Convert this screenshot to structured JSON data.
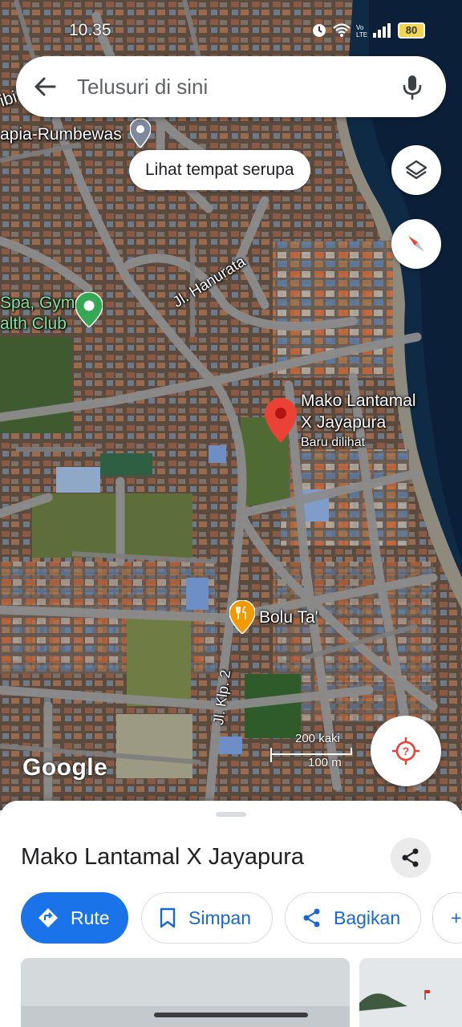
{
  "status_bar": {
    "time": "10.35",
    "battery": "80"
  },
  "search": {
    "placeholder": "Telusuri di sini"
  },
  "map": {
    "labels": {
      "area_top_left": "ibi",
      "rumbewas": "apia-Rumbewas",
      "spa_line1": "Spa, Gym",
      "spa_line2": "alth Club",
      "street_hanurata": "Jl. Hanurata",
      "place_name_line1": "Mako Lantamal",
      "place_name_line2": "X Jayapura",
      "place_sub": "Baru dilihat",
      "bolu": "Bolu Ta'",
      "street_klp": "Jl. Klp. 2"
    },
    "similar_places_chip": "Lihat tempat serupa",
    "scale": {
      "feet": "200 kaki",
      "meters": "100 m"
    },
    "logo": "Google"
  },
  "place": {
    "title": "Mako Lantamal X Jayapura",
    "actions": {
      "route": "Rute",
      "save": "Simpan",
      "share": "Bagikan",
      "more": "+"
    }
  },
  "icons": {
    "back": "arrow-left-icon",
    "mic": "microphone-icon",
    "layers": "layers-icon",
    "compass": "compass-icon",
    "location": "my-location-icon",
    "share": "share-icon",
    "route": "directions-icon",
    "save": "bookmark-icon",
    "pin": "map-pin-icon",
    "restaurant": "restaurant-icon"
  },
  "colors": {
    "accent": "#1a73e8",
    "pin_red": "#ea4335",
    "pin_green": "#34a853",
    "pin_orange": "#f29900"
  }
}
